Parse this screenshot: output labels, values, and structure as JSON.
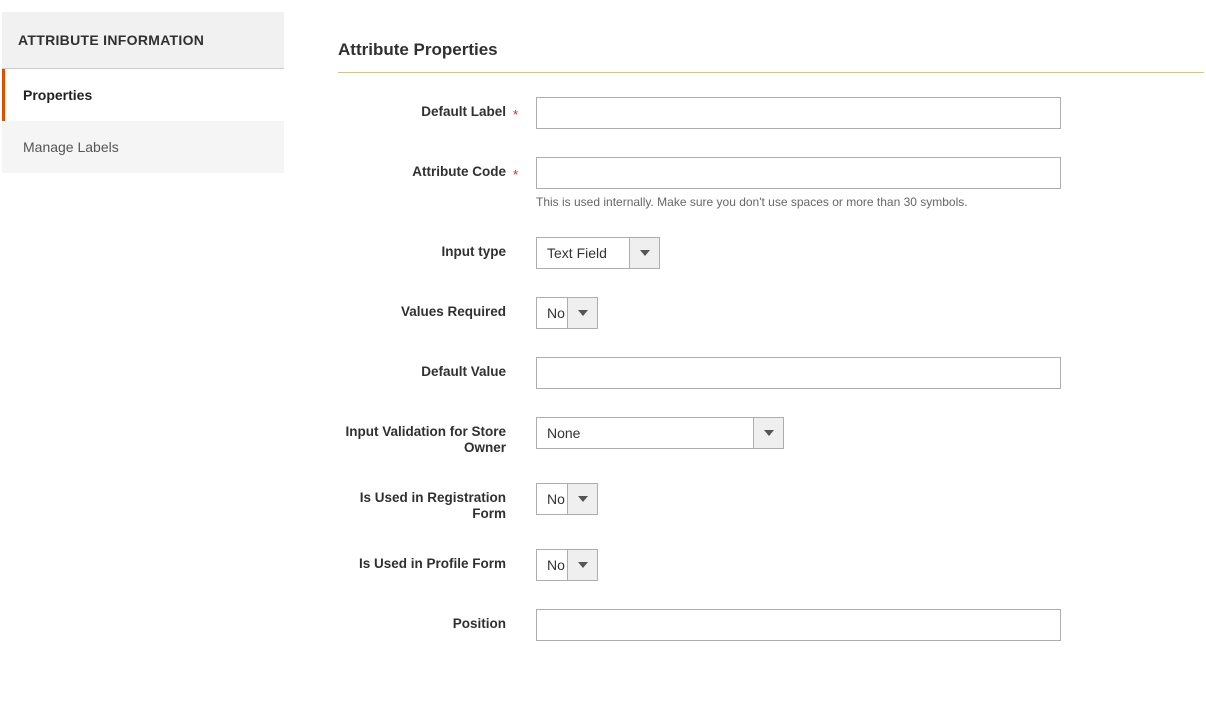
{
  "sidebar": {
    "header": "ATTRIBUTE INFORMATION",
    "items": [
      {
        "label": "Properties",
        "active": true
      },
      {
        "label": "Manage Labels",
        "active": false
      }
    ]
  },
  "section_title": "Attribute Properties",
  "fields": {
    "default_label": {
      "label": "Default Label",
      "required": true,
      "value": ""
    },
    "attribute_code": {
      "label": "Attribute Code",
      "required": true,
      "value": "",
      "hint": "This is used internally. Make sure you don't use spaces or more than 30 symbols."
    },
    "input_type": {
      "label": "Input type",
      "value": "Text Field"
    },
    "values_required": {
      "label": "Values Required",
      "value": "No"
    },
    "default_value": {
      "label": "Default Value",
      "value": ""
    },
    "input_validation": {
      "label": "Input Validation for Store Owner",
      "value": "None"
    },
    "used_registration": {
      "label": "Is Used in Registration Form",
      "value": "No"
    },
    "used_profile": {
      "label": "Is Used in Profile Form",
      "value": "No"
    },
    "position": {
      "label": "Position",
      "value": ""
    }
  },
  "required_mark": "*"
}
